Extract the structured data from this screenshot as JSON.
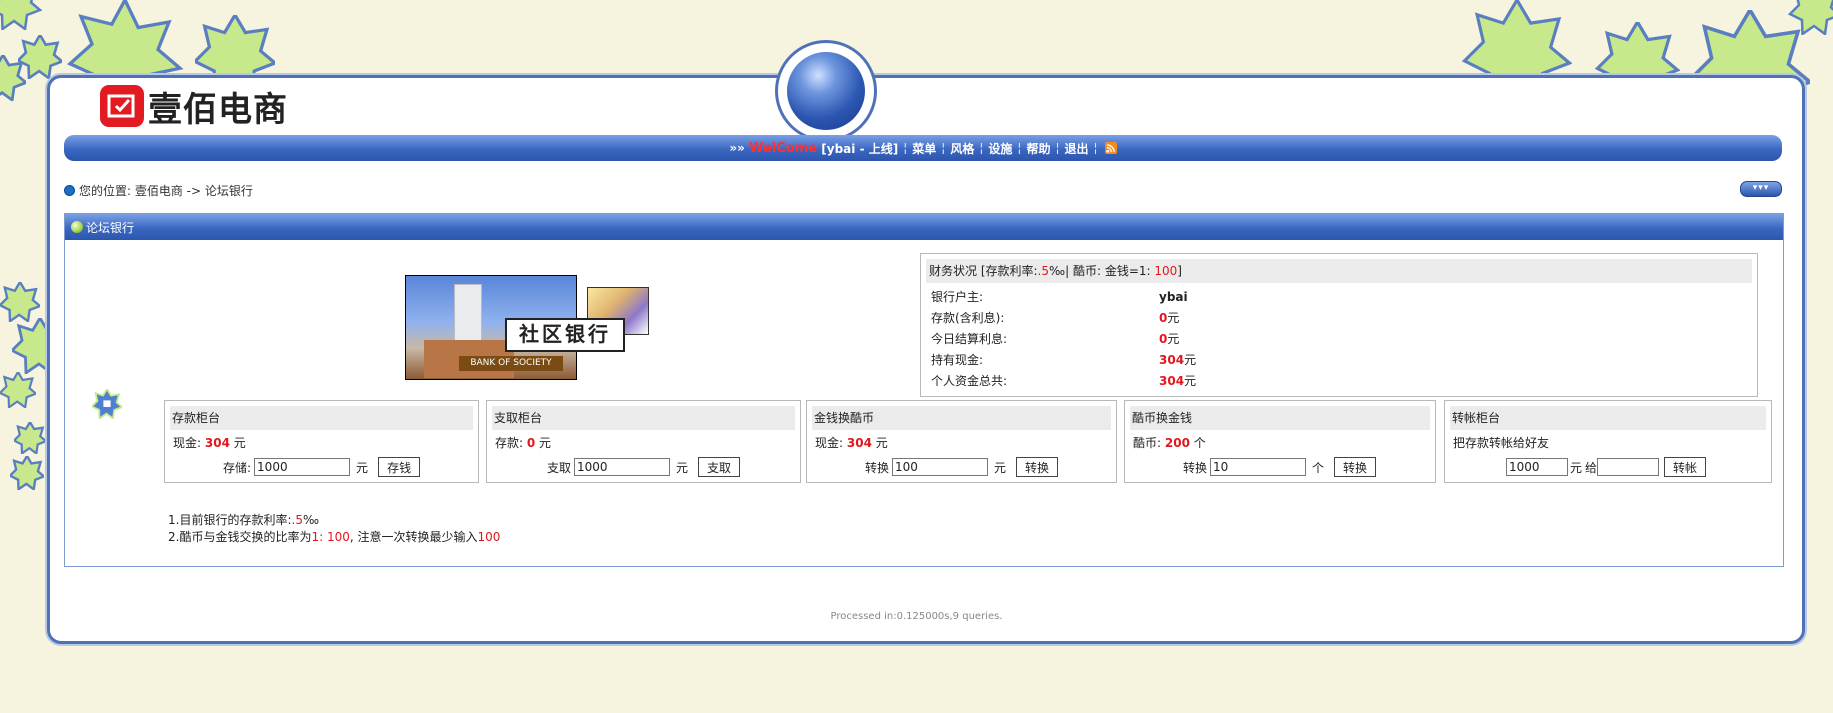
{
  "logo": {
    "text": "壹佰电商"
  },
  "nav": {
    "prefix": "»»",
    "welcome": "WelCome",
    "user_status": "[ybai - 上线]",
    "items": [
      "菜单",
      "风格",
      "设施",
      "帮助",
      "退出"
    ]
  },
  "breadcrumb": {
    "text": "您的位置: 壹佰电商 -> 论坛银行"
  },
  "panel": {
    "title": "论坛银行"
  },
  "bank_image": {
    "title": "社区银行",
    "subtitle": "BANK OF SOCIETY"
  },
  "finance": {
    "header_prefix": "财务状况 [存款利率:",
    "rate": ".5",
    "header_mid": "‰| 酷币: 金钱=1:",
    "exchange_rate": "100",
    "header_suffix": "]",
    "rows": [
      {
        "label": "银行户主:",
        "value": "ybai",
        "unit": ""
      },
      {
        "label": "存款(含利息):",
        "value": "0",
        "unit": " 元"
      },
      {
        "label": "今日结算利息:",
        "value": "0",
        "unit": " 元"
      },
      {
        "label": "持有现金:",
        "value": "304",
        "unit": " 元"
      },
      {
        "label": "个人资金总共:",
        "value": "304",
        "unit": " 元"
      }
    ]
  },
  "deposit": {
    "title": "存款柜台",
    "info_label": "现金:",
    "info_value": "304",
    "info_unit": " 元",
    "action_label": "存储:",
    "input_value": "1000",
    "unit": "元",
    "button": "存钱"
  },
  "withdraw": {
    "title": "支取柜台",
    "info_label": "存款:",
    "info_value": "0",
    "info_unit": " 元",
    "action_label": "支取",
    "input_value": "1000",
    "unit": "元",
    "button": "支取"
  },
  "money_to_coin": {
    "title": "金钱换酷币",
    "info_label": "现金:",
    "info_value": "304",
    "info_unit": " 元",
    "action_label": "转换",
    "input_value": "100",
    "unit": "元",
    "button": "转换"
  },
  "coin_to_money": {
    "title": "酷币换金钱",
    "info_label": "酷币:",
    "info_value": "200",
    "info_unit": " 个",
    "action_label": "转换",
    "input_value": "10",
    "unit": "个",
    "button": "转换"
  },
  "transfer": {
    "title": "转帐柜台",
    "info_text": "把存款转帐给好友",
    "amount_value": "1000",
    "unit": "元",
    "to_label": "给",
    "friend_value": "",
    "button": "转帐"
  },
  "notes": {
    "line1_prefix": "1.目前银行的存款利率:",
    "line1_rate": ".5",
    "line1_suffix": "‰",
    "line2_prefix": "2.酷币与金钱交换的比率为",
    "line2_ratio": "1: 100",
    "line2_mid": ", 注意一次转换最少输入",
    "line2_min": "100"
  },
  "footer": {
    "text": "Processed in:0.125000s,9 queries."
  },
  "colors": {
    "accent_blue": "#3b67c1",
    "value_red": "#e2171d",
    "background": "#f6f3df"
  }
}
